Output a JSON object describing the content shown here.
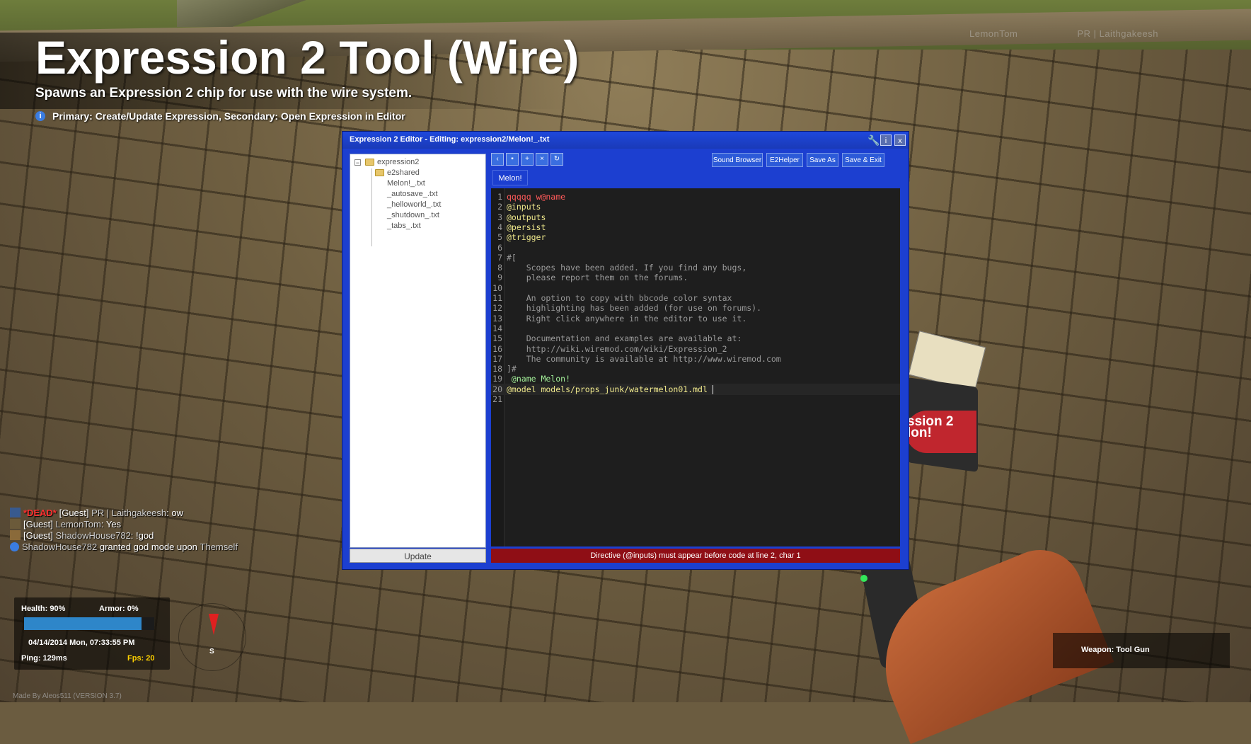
{
  "tool": {
    "title": "Expression 2 Tool (Wire)",
    "description": "Spawns an Expression 2 chip for use with the wire system.",
    "hint": "Primary: Create/Update Expression, Secondary: Open Expression in Editor"
  },
  "world": {
    "far_names": [
      "LemonTom",
      "PR | Laithgakeesh"
    ],
    "prop_label": "ssion 2\nlon!"
  },
  "editor": {
    "title": "Expression 2 Editor - Editing: expression2/Melon!_.txt",
    "close_label": "x",
    "info_label": "i",
    "tree": {
      "root": "expression2",
      "items": [
        "e2shared",
        "Melon!_.txt",
        "_autosave_.txt",
        "_helloworld_.txt",
        "_shutdown_.txt",
        "_tabs_.txt"
      ]
    },
    "update_label": "Update",
    "toolbar_buttons": [
      "Sound Browser",
      "E2Helper",
      "Save As",
      "Save & Exit"
    ],
    "tab_label": "Melon!",
    "code_lines": [
      "qqqqq w@name",
      "@inputs",
      "@outputs",
      "@persist",
      "@trigger",
      "",
      "#[",
      "    Scopes have been added. If you find any bugs,",
      "    please report them on the forums.",
      "",
      "    An option to copy with bbcode color syntax",
      "    highlighting has been added (for use on forums).",
      "    Right click anywhere in the editor to use it.",
      "",
      "    Documentation and examples are available at:",
      "    http://wiki.wiremod.com/wiki/Expression_2",
      "    The community is available at http://www.wiremod.com",
      "]#",
      " @name Melon!",
      "@model models/props_junk/watermelon01.mdl ",
      ""
    ],
    "line_numbers": [
      "1",
      "2",
      "3",
      "4",
      "5",
      "6",
      "7",
      "8",
      "9",
      "10",
      "11",
      "12",
      "13",
      "14",
      "15",
      "16",
      "17",
      "18",
      "19",
      "20",
      "21"
    ],
    "error": "Directive (@inputs) must appear before code at line 2, char 1"
  },
  "chat": [
    {
      "dead": "*DEAD*",
      "guest": "[Guest]",
      "player": "PR | Laithgakeesh",
      "message": ": ow"
    },
    {
      "dead": "",
      "guest": "[Guest]",
      "player": "LemonTom",
      "message": ": Yes"
    },
    {
      "dead": "",
      "guest": "[Guest]",
      "player": "ShadowHouse782",
      "message": ": !god"
    },
    {
      "dead": "",
      "guest": "",
      "player": "ShadowHouse782",
      "message": " granted god mode upon ",
      "target": "Themself"
    }
  ],
  "hud": {
    "health_label": "Health: 90%",
    "armor_label": "Armor: 0%",
    "health_value": 0.9,
    "datetime": "04/14/2014 Mon, 07:33:55 PM",
    "ping": "Ping: 129ms",
    "fps_label": "Fps:",
    "fps_value": "20",
    "compass_dir": "S",
    "weapon": "Weapon: Tool Gun",
    "credit": "Made By Aleos511 (VERSION 3.7)"
  },
  "colors": {
    "editor_frame": "#1c3fd0",
    "error_bar": "#8f0e15",
    "health_bar": "#2e86c9",
    "fps": "#ffd200",
    "dead_tag": "#ff3030"
  }
}
